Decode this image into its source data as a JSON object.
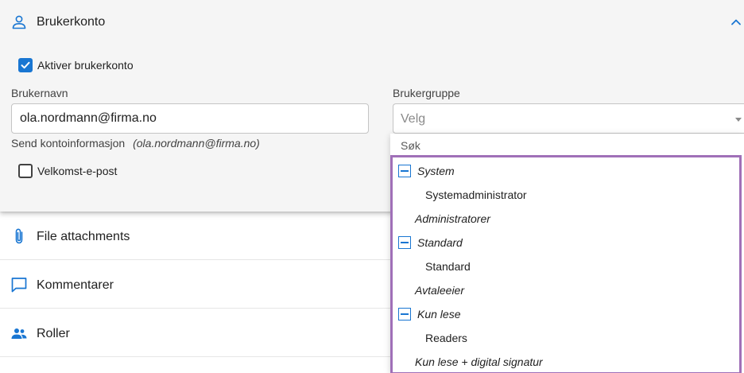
{
  "panel": {
    "title": "Brukerkonto",
    "activate_label": "Aktiver brukerkonto",
    "activate_checked": true,
    "username_label": "Brukernavn",
    "username_value": "ola.nordmann@firma.no",
    "send_info_label": "Send kontoinformasjon",
    "send_info_email": "(ola.nordmann@firma.no)",
    "welcome_label": "Velkomst-e-post",
    "welcome_checked": false,
    "group_label": "Brukergruppe",
    "group_placeholder": "Velg"
  },
  "sections": [
    {
      "title": "File attachments",
      "icon": "paperclip-icon"
    },
    {
      "title": "Kommentarer",
      "icon": "comment-icon"
    },
    {
      "title": "Roller",
      "icon": "people-icon"
    }
  ],
  "dropdown": {
    "search_placeholder": "Søk",
    "items": [
      {
        "label": "System",
        "type": "group",
        "collapsible": true
      },
      {
        "label": "Systemadministrator",
        "type": "option"
      },
      {
        "label": "Administratorer",
        "type": "group",
        "collapsible": false
      },
      {
        "label": "Standard",
        "type": "group",
        "collapsible": true
      },
      {
        "label": "Standard",
        "type": "option"
      },
      {
        "label": "Avtaleeier",
        "type": "group",
        "collapsible": false
      },
      {
        "label": "Kun lese",
        "type": "group",
        "collapsible": true
      },
      {
        "label": "Readers",
        "type": "option"
      },
      {
        "label": "Kun lese + digital signatur",
        "type": "group",
        "collapsible": false
      }
    ]
  },
  "colors": {
    "accent": "#1976d2",
    "highlight_border": "#a070b8",
    "panel_bg": "#f5f5f5"
  }
}
